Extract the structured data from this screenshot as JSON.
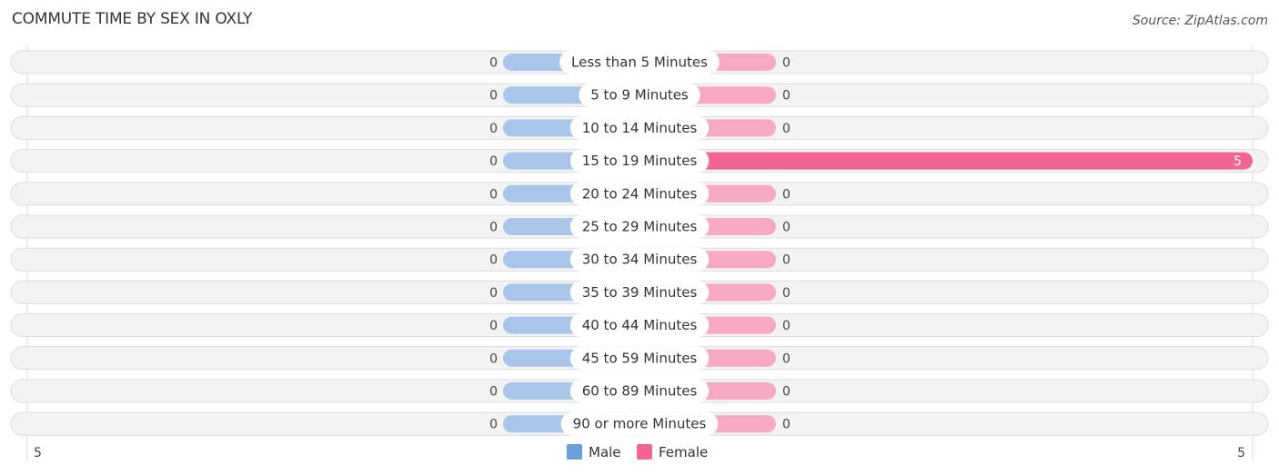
{
  "chart_data": {
    "type": "bar",
    "orientation": "horizontal-diverging",
    "title": "COMMUTE TIME BY SEX IN OXLY",
    "source": "Source: ZipAtlas.com",
    "categories": [
      "Less than 5 Minutes",
      "5 to 9 Minutes",
      "10 to 14 Minutes",
      "15 to 19 Minutes",
      "20 to 24 Minutes",
      "25 to 29 Minutes",
      "30 to 34 Minutes",
      "35 to 39 Minutes",
      "40 to 44 Minutes",
      "45 to 59 Minutes",
      "60 to 89 Minutes",
      "90 or more Minutes"
    ],
    "series": [
      {
        "name": "Male",
        "color": "#a9c6ea",
        "legend_color": "#6a9fdb",
        "values": [
          0,
          0,
          0,
          0,
          0,
          0,
          0,
          0,
          0,
          0,
          0,
          0
        ]
      },
      {
        "name": "Female",
        "color": "#f7a8c2",
        "strong_color": "#f06593",
        "legend_color": "#f06593",
        "values": [
          0,
          0,
          0,
          5,
          0,
          0,
          0,
          0,
          0,
          0,
          0,
          0
        ]
      }
    ],
    "axis": {
      "left_tick": "5",
      "right_tick": "5",
      "range": [
        0,
        5
      ]
    },
    "legend": {
      "position": "bottom-center",
      "entries": [
        "Male",
        "Female"
      ]
    }
  }
}
